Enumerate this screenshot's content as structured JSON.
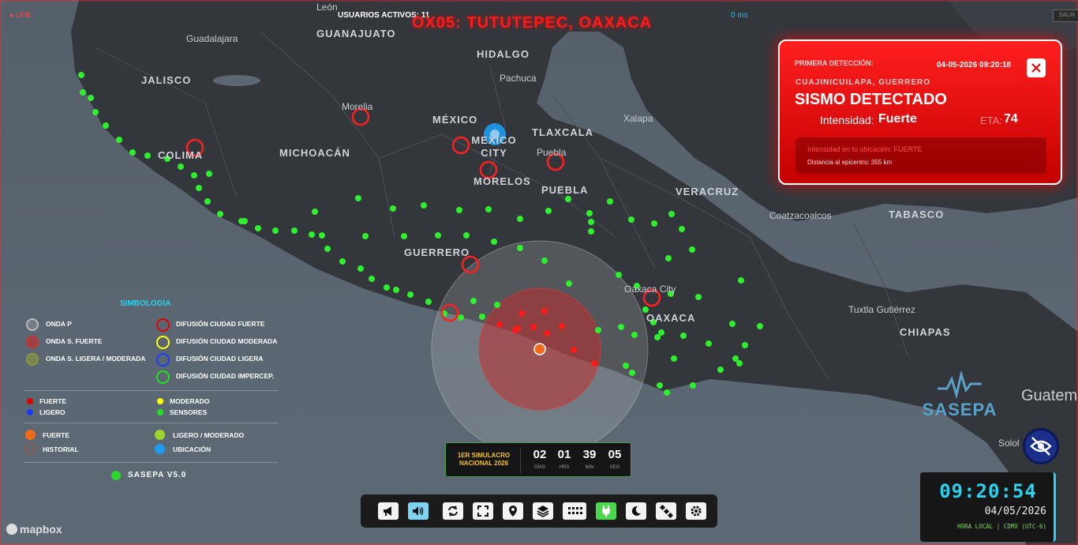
{
  "header": {
    "live": "● LIVE",
    "users": "USUARIOS ACTIVOS: 11",
    "ping": "0 ms",
    "title": "OX05: TUTUTEPEC, OAXACA",
    "exit": "SALIR"
  },
  "map": {
    "states": [
      {
        "id": "guanajuato",
        "label": "GUANAJUATO"
      },
      {
        "id": "hidalgo",
        "label": "HIDALGO"
      },
      {
        "id": "jalisco",
        "label": "JALISCO"
      },
      {
        "id": "mexico",
        "label": "MÉXICO"
      },
      {
        "id": "tlaxcala",
        "label": "TLAXCALA"
      },
      {
        "id": "colima",
        "label": "COLIMA"
      },
      {
        "id": "michoacan",
        "label": "MICHOACÁN"
      },
      {
        "id": "mexico-city",
        "label": "MEXICO CITY"
      },
      {
        "id": "morelos",
        "label": "MORELOS"
      },
      {
        "id": "puebla",
        "label": "PUEBLA"
      },
      {
        "id": "veracruz",
        "label": "VERACRUZ"
      },
      {
        "id": "tabasco",
        "label": "TABASCO"
      },
      {
        "id": "guerrero",
        "label": "GUERRERO"
      },
      {
        "id": "oaxaca",
        "label": "OAXACA"
      },
      {
        "id": "chiapas",
        "label": "CHIAPAS"
      }
    ],
    "cities": [
      {
        "id": "leon",
        "label": "León"
      },
      {
        "id": "guadalajara",
        "label": "Guadalajara"
      },
      {
        "id": "pachuca",
        "label": "Pachuca"
      },
      {
        "id": "morelia",
        "label": "Morelia"
      },
      {
        "id": "xalapa",
        "label": "Xalapa"
      },
      {
        "id": "puebla-city",
        "label": "Puebla"
      },
      {
        "id": "coatzacoalcos",
        "label": "Coatzacoalcos"
      },
      {
        "id": "oaxaca-city",
        "label": "Oaxaca City"
      },
      {
        "id": "tuxtla",
        "label": "Tuxtla Gutiérrez"
      },
      {
        "id": "guatemala",
        "label": "Guatem"
      },
      {
        "id": "solola",
        "label": "Solol"
      }
    ]
  },
  "alert": {
    "first_detection_label": "PRIMERA DETECCIÓN:",
    "datetime": "04-05-2026 09:20:18",
    "close_icon": "close-icon",
    "location": "CUAJINICUILAPA, GUERRERO",
    "headline": "SISMO DETECTADO",
    "intensity_label": "Intensidad:",
    "intensity_value": "Fuerte",
    "eta_label": "ETA:",
    "eta_value": "74",
    "local_intensity": "Intensidad en tu ubicación: FUERTE",
    "distance": "Distancia al epicentro: 355 km"
  },
  "legend": {
    "title": "SIMBOLOGÍA",
    "onda_p": "ONDA P",
    "onda_s_fuerte": "ONDA S. FUERTE",
    "onda_s_ligera": "ONDA S. LIGERA / MODERADA",
    "dif_fuerte": "DIFUSIÓN CIUDAD FUERTE",
    "dif_moderada": "DIFUSIÓN CIUDAD MODERADA",
    "dif_ligera": "DIFUSIÓN CIUDAD LIGERA",
    "dif_imper": "DIFUSIÓN CIUDAD IMPERCEP.",
    "fuerte": "FUERTE",
    "moderado": "MODERADO",
    "ligero": "LIGERO",
    "sensores": "SENSORES",
    "epi_fuerte": "FUERTE",
    "epi_ligero": "LIGERO / MODERADO",
    "historial": "HISTORIAL",
    "ubicacion": "UBICACIÓN",
    "version": "SASEPA V5.0",
    "colors": {
      "red": "#e00000",
      "yellow": "#ffff00",
      "blue": "#1a3bff",
      "green": "#22e022",
      "orange": "#f06a1a",
      "lime": "#9ad62e",
      "cyan": "#1e9bf0"
    }
  },
  "countdown": {
    "label_line1": "1ER SIMULACRO",
    "label_line2": "NACIONAL 2026",
    "days": "02",
    "hours": "01",
    "minutes": "39",
    "seconds": "05",
    "u_days": "DÍAS",
    "u_hours": "HRS",
    "u_minutes": "MIN",
    "u_seconds": "SEG"
  },
  "toolbar": {
    "buttons": [
      "megaphone-icon",
      "volume-icon",
      "refresh-icon",
      "fullscreen-icon",
      "location-pin-icon",
      "layers-icon",
      "grid-icon",
      "plug-icon",
      "moon-icon",
      "satellite-icon",
      "settings-icon"
    ]
  },
  "clock": {
    "time": "09:20:54",
    "date": "04/05/2026",
    "zone": "HORA LOCAL | CDMX (UTC-6)"
  },
  "brand": {
    "name": "SASEPA",
    "mapbox": "mapbox"
  }
}
